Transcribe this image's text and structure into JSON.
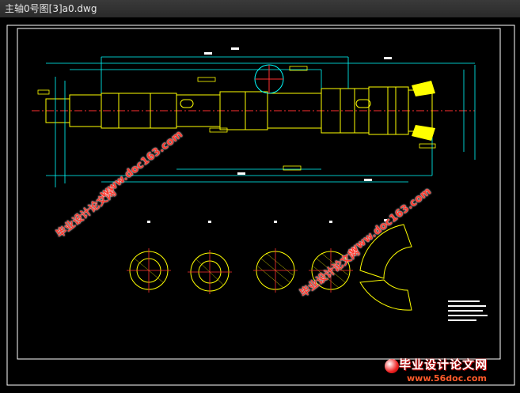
{
  "window": {
    "title": "主轴0号图[3]a0.dwg"
  },
  "watermarks": [
    {
      "text": "毕业设计论文网"
    },
    {
      "text": "www.doc163.com"
    },
    {
      "text": "毕业设计论文网"
    },
    {
      "text": "www.doc163.com"
    }
  ],
  "brand": {
    "name": "毕业设计论文网",
    "url": "www.56doc.com",
    "logo_icon": "red-globe-icon"
  },
  "colors": {
    "drawing_lines": "#ffff00",
    "frame": "#ffffff",
    "centerline": "#ff3030",
    "dimension": "#00ffff",
    "hatch": "#ffff00",
    "watermark": "#ff3b30"
  }
}
